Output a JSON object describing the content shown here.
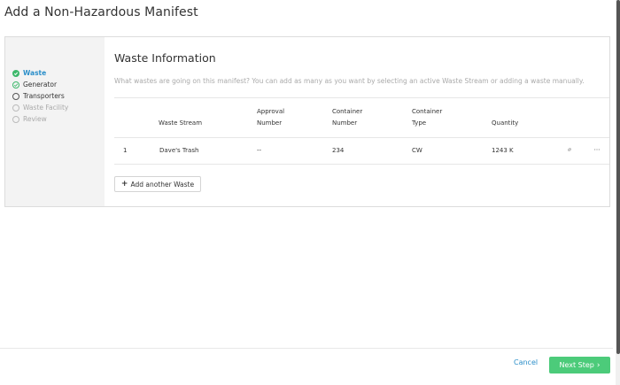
{
  "page": {
    "title": "Add a Non-Hazardous Manifest"
  },
  "steps": [
    {
      "label": "Waste",
      "state": "active"
    },
    {
      "label": "Generator",
      "state": "complete"
    },
    {
      "label": "Transporters",
      "state": "pending"
    },
    {
      "label": "Waste Facility",
      "state": "disabled"
    },
    {
      "label": "Review",
      "state": "disabled"
    }
  ],
  "section": {
    "title": "Waste Information",
    "description": "What wastes are going on this manifest? You can add as many as you want by selecting an active Waste Stream or adding a waste manually."
  },
  "table": {
    "headers": {
      "waste_stream": "Waste Stream",
      "approval_line1": "Approval",
      "approval_line2": "Number",
      "container_number_line1": "Container",
      "container_number_line2": "Number",
      "container_type_line1": "Container",
      "container_type_line2": "Type",
      "quantity": "Quantity"
    },
    "rows": [
      {
        "index": "1",
        "waste_stream": "Dave's Trash",
        "approval_number": "--",
        "container_number": "234",
        "container_type": "CW",
        "quantity": "1243 K"
      }
    ]
  },
  "actions": {
    "add_waste": "Add another Waste",
    "cancel": "Cancel",
    "next": "Next Step"
  },
  "icons": {
    "link": "link-icon",
    "more": "more-icon",
    "plus": "plus-icon",
    "chevron": "chevron-right-icon"
  },
  "colors": {
    "accent_blue": "#2a8ec9",
    "accent_green": "#3db86b",
    "button_green": "#4ccb7a"
  }
}
